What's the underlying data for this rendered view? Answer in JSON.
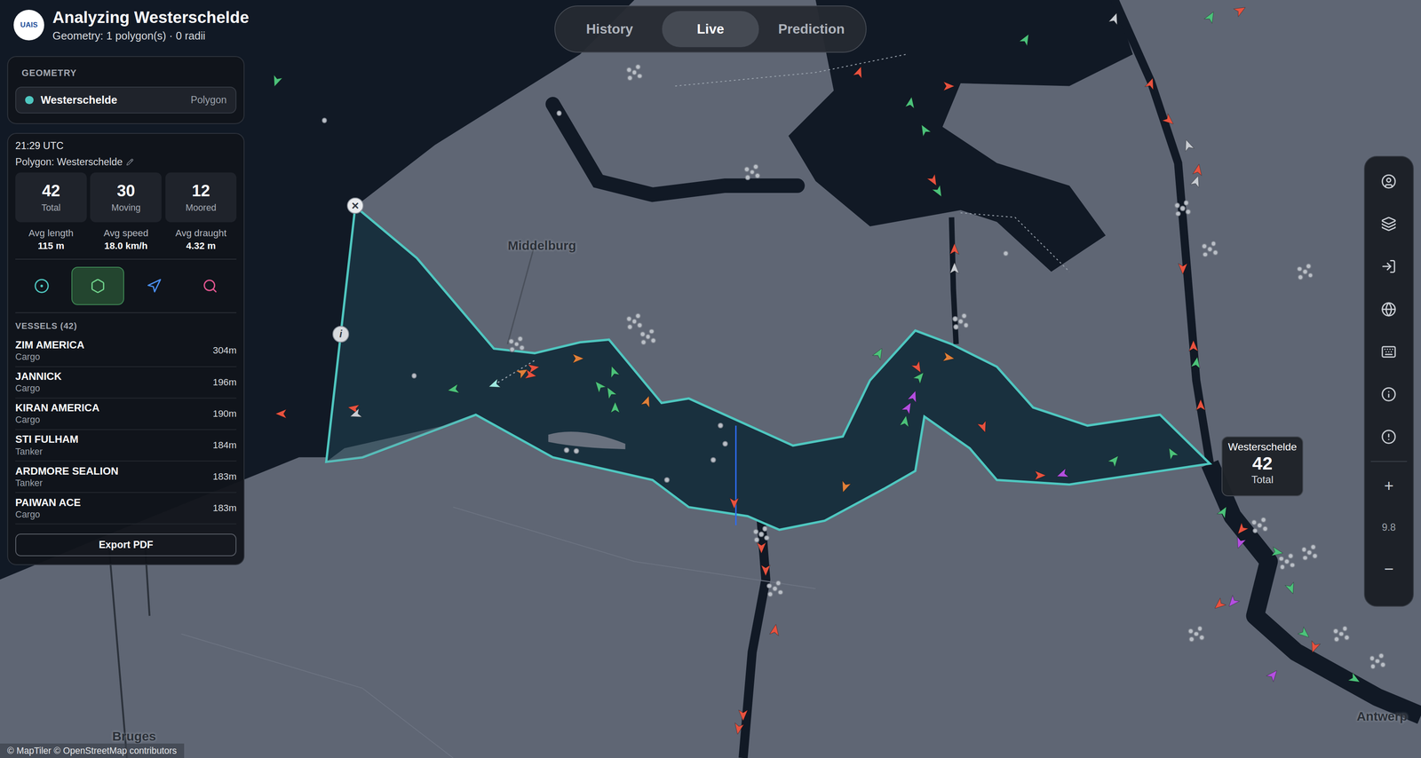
{
  "header": {
    "logo": "UAIS",
    "title": "Analyzing Westerschelde",
    "subtitle": "Geometry: 1 polygon(s) · 0 radii"
  },
  "modes": [
    {
      "label": "History",
      "selected": false
    },
    {
      "label": "Live",
      "selected": true
    },
    {
      "label": "Prediction",
      "selected": false
    }
  ],
  "geometry": {
    "heading": "GEOMETRY",
    "items": [
      {
        "name": "Westerschelde",
        "type": "Polygon",
        "color": "#4fc7c0"
      }
    ]
  },
  "stats": {
    "time": "21:29 UTC",
    "polygon_label": "Polygon: Westerschelde",
    "counts": [
      {
        "value": "42",
        "label": "Total"
      },
      {
        "value": "30",
        "label": "Moving"
      },
      {
        "value": "12",
        "label": "Moored"
      }
    ],
    "averages": [
      {
        "label": "Avg length",
        "value": "115 m"
      },
      {
        "label": "Avg speed",
        "value": "18.0 km/h"
      },
      {
        "label": "Avg draught",
        "value": "4.32 m"
      }
    ],
    "tools": [
      {
        "kind": "radius",
        "selected": false
      },
      {
        "kind": "polygon",
        "selected": true
      },
      {
        "kind": "route",
        "selected": false
      },
      {
        "kind": "search",
        "selected": false
      }
    ],
    "vessels_heading": "VESSELS (42)",
    "vessels": [
      {
        "name": "ZIM AMERICA",
        "type": "Cargo",
        "length": "304m"
      },
      {
        "name": "JANNICK",
        "type": "Cargo",
        "length": "196m"
      },
      {
        "name": "KIRAN AMERICA",
        "type": "Cargo",
        "length": "190m"
      },
      {
        "name": "STI FULHAM",
        "type": "Tanker",
        "length": "184m"
      },
      {
        "name": "ARDMORE SEALION",
        "type": "Tanker",
        "length": "183m"
      },
      {
        "name": "PAIWAN ACE",
        "type": "Cargo",
        "length": "183m"
      }
    ],
    "export": "Export PDF"
  },
  "map": {
    "labels": [
      "Middelburg",
      "Bruges",
      "Antwerp"
    ],
    "polygon_close": "×",
    "polygon_info": "i",
    "tooltip": {
      "title": "Westerschelde",
      "value": "42",
      "label": "Total"
    },
    "attribution": "© MapTiler © OpenStreetMap contributors",
    "markers": [
      {
        "color": "#4cc27a",
        "heading": 200
      },
      {
        "color": "#e8523f",
        "heading": 270
      },
      {
        "color": "#e8523f",
        "heading": 280
      },
      {
        "color": "#c8ccd2",
        "heading": 250
      },
      {
        "color": "#4cc27a",
        "heading": 260
      },
      {
        "color": "#9ee8e0",
        "heading": 250
      },
      {
        "color": "#e0803a",
        "heading": 60
      },
      {
        "color": "#e8523f",
        "heading": 80
      },
      {
        "color": "#e8523f",
        "heading": 100
      },
      {
        "color": "#e0803a",
        "heading": 90
      },
      {
        "color": "#4cc27a",
        "heading": 340
      },
      {
        "color": "#4cc27a",
        "heading": 320
      },
      {
        "color": "#4cc27a",
        "heading": 330
      },
      {
        "color": "#4cc27a",
        "heading": 0
      },
      {
        "color": "#e0803a",
        "heading": 20
      },
      {
        "color": "#e8523f",
        "heading": 180
      },
      {
        "color": "#e0803a",
        "heading": 200
      },
      {
        "color": "#4cc27a",
        "heading": 30
      },
      {
        "color": "#e8523f",
        "heading": 150
      },
      {
        "color": "#4cc27a",
        "heading": 40
      },
      {
        "color": "#b44fe0",
        "heading": 20
      },
      {
        "color": "#b44fe0",
        "heading": 30
      },
      {
        "color": "#4cc27a",
        "heading": 10
      },
      {
        "color": "#e0803a",
        "heading": 100
      },
      {
        "color": "#e8523f",
        "heading": 160
      },
      {
        "color": "#e8523f",
        "heading": 90
      },
      {
        "color": "#b44fe0",
        "heading": 250
      },
      {
        "color": "#4cc27a",
        "heading": 40
      },
      {
        "color": "#4cc27a",
        "heading": 330
      },
      {
        "color": "#e8523f",
        "heading": 20
      },
      {
        "color": "#e8523f",
        "heading": 90
      },
      {
        "color": "#4cc27a",
        "heading": 10
      },
      {
        "color": "#4cc27a",
        "heading": 30
      },
      {
        "color": "#4cc27a",
        "heading": 330
      },
      {
        "color": "#e8523f",
        "heading": 150
      },
      {
        "color": "#4cc27a",
        "heading": 150
      },
      {
        "color": "#e8523f",
        "heading": 0
      },
      {
        "color": "#c8ccd2",
        "heading": 0
      },
      {
        "color": "#e8523f",
        "heading": 20
      },
      {
        "color": "#e8523f",
        "heading": 130
      },
      {
        "color": "#c8ccd2",
        "heading": 340
      },
      {
        "color": "#e8523f",
        "heading": 10
      },
      {
        "color": "#c8ccd2",
        "heading": 20
      },
      {
        "color": "#e8523f",
        "heading": 180
      },
      {
        "color": "#e8523f",
        "heading": 0
      },
      {
        "color": "#4cc27a",
        "heading": 10
      },
      {
        "color": "#e8523f",
        "heading": 0
      },
      {
        "color": "#4cc27a",
        "heading": 30
      },
      {
        "color": "#e8523f",
        "heading": 60
      },
      {
        "color": "#4cc27a",
        "heading": 30
      },
      {
        "color": "#b44fe0",
        "heading": 200
      },
      {
        "color": "#e8523f",
        "heading": 220
      },
      {
        "color": "#4cc27a",
        "heading": 100
      },
      {
        "color": "#4cc27a",
        "heading": 160
      },
      {
        "color": "#b44fe0",
        "heading": 220
      },
      {
        "color": "#e8523f",
        "heading": 230
      },
      {
        "color": "#4cc27a",
        "heading": 130
      },
      {
        "color": "#e8523f",
        "heading": 200
      },
      {
        "color": "#4cc27a",
        "heading": 120
      },
      {
        "color": "#b44fe0",
        "heading": 40
      },
      {
        "color": "#e8523f",
        "heading": 180
      },
      {
        "color": "#e8523f",
        "heading": 180
      },
      {
        "color": "#e8523f",
        "heading": 10
      },
      {
        "color": "#e8523f",
        "heading": 180
      },
      {
        "color": "#e8523f",
        "heading": 190
      },
      {
        "color": "#c8ccd2",
        "heading": 20
      }
    ]
  },
  "toolbar": {
    "zoom": "9.8",
    "zoom_in": "+",
    "zoom_out": "−"
  }
}
